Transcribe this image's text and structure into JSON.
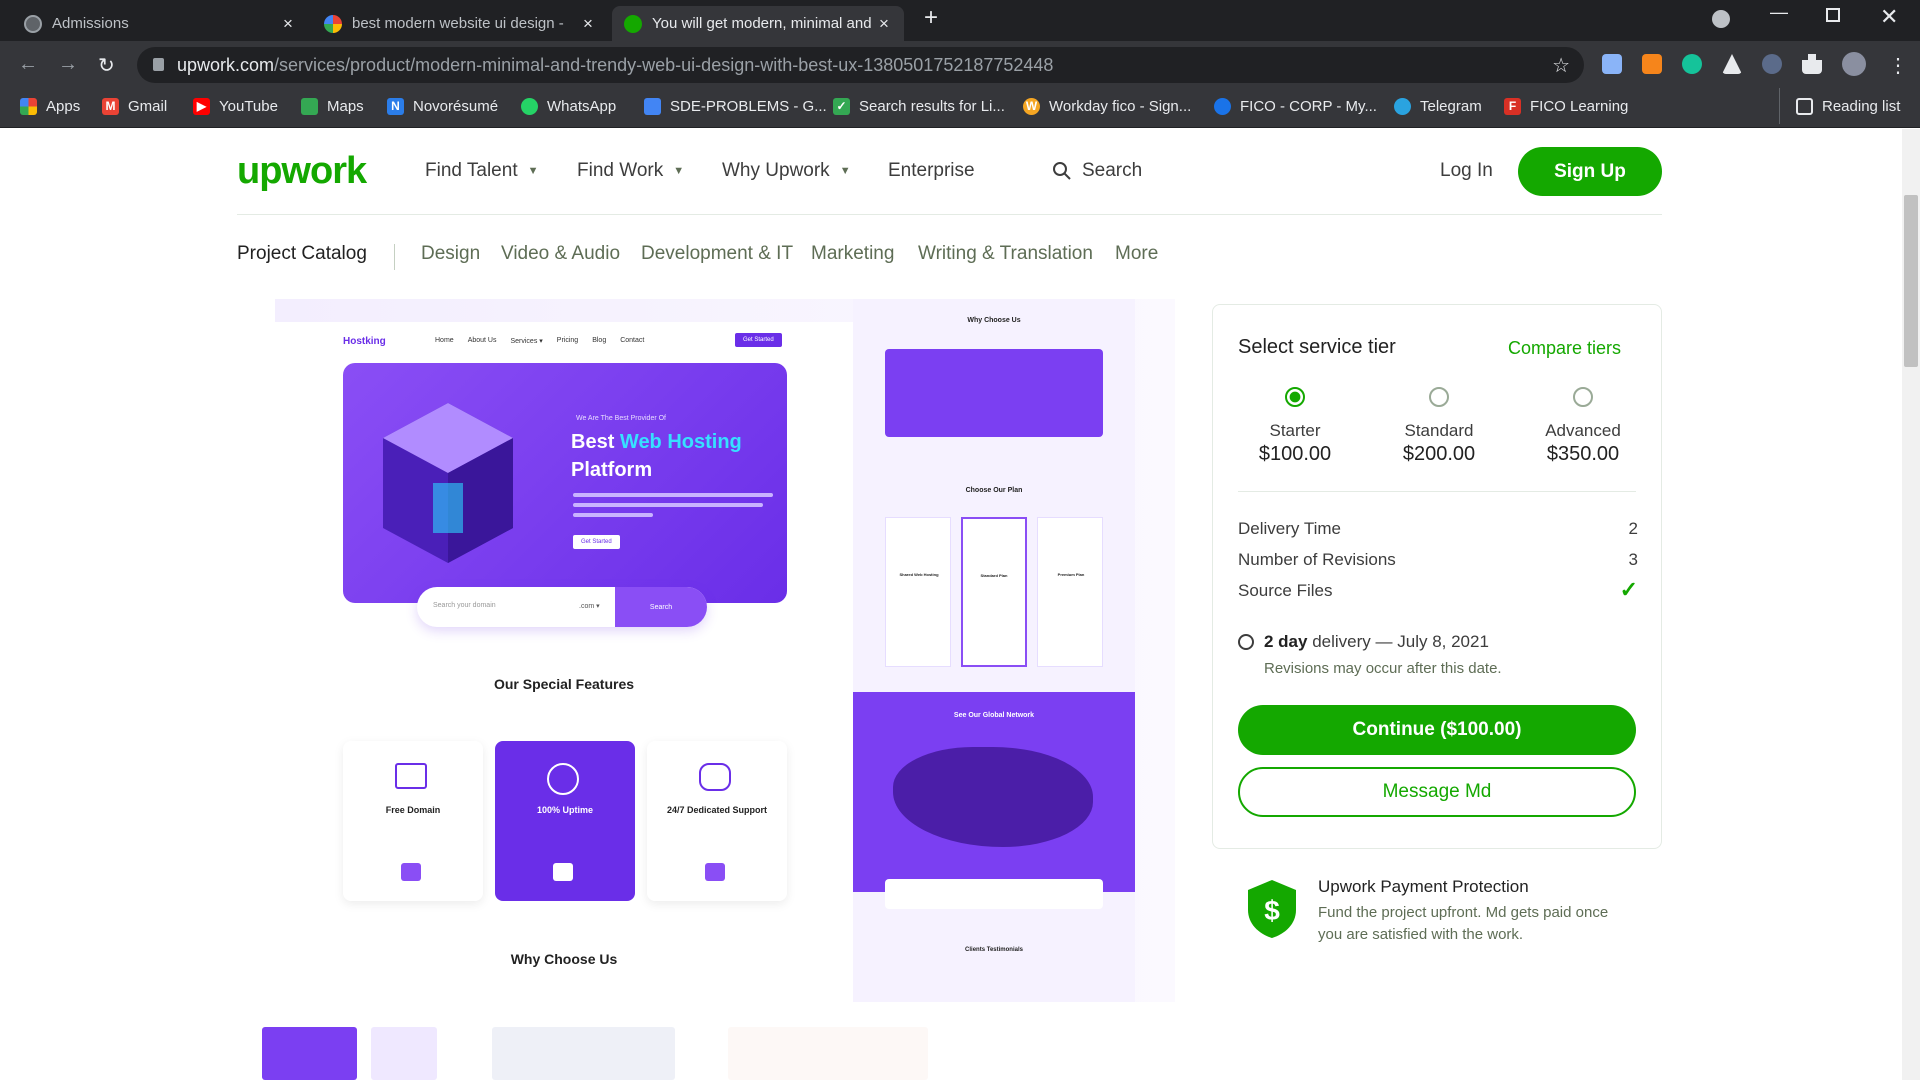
{
  "browser": {
    "tabs": [
      {
        "title": "Admissions"
      },
      {
        "title": "best modern website ui design -"
      },
      {
        "title": "You will get modern, minimal and"
      }
    ],
    "url_host": "upwork.com",
    "url_path": "/services/product/modern-minimal-and-trendy-web-ui-design-with-best-ux-1380501752187752448",
    "bookmarks": [
      "Apps",
      "Gmail",
      "YouTube",
      "Maps",
      "Novorésumé",
      "WhatsApp",
      "SDE-PROBLEMS - G...",
      "Search results for Li...",
      "Workday fico - Sign...",
      "FICO - CORP - My...",
      "Telegram",
      "FICO Learning"
    ],
    "reading_list": "Reading list"
  },
  "header": {
    "logo": "upwork",
    "nav": [
      "Find Talent",
      "Find Work",
      "Why Upwork",
      "Enterprise"
    ],
    "search": "Search",
    "login": "Log In",
    "signup": "Sign Up"
  },
  "categories": [
    "Project Catalog",
    "Design",
    "Video & Audio",
    "Development & IT",
    "Marketing",
    "Writing & Translation",
    "More"
  ],
  "preview": {
    "brand": "Hostking",
    "menu": [
      "Home",
      "About Us",
      "Services ▾",
      "Pricing",
      "Blog",
      "Contact"
    ],
    "cta": "Get Started",
    "hero_kicker": "We Are The Best Provider Of",
    "hero_title_1": "Best",
    "hero_title_accent": "Web Hosting",
    "hero_title_2": "Platform",
    "hero_button": "Get Started",
    "domain_placeholder": "Search your domain",
    "domain_tld": ".com ▾",
    "domain_button": "Search",
    "features_title": "Our Special Features",
    "features": [
      "Free Domain",
      "100% Uptime",
      "24/7 Dedicated Support"
    ],
    "why_title": "Why Choose Us",
    "right_why": "Why Choose Us",
    "right_plan": "Choose Our Plan",
    "plans": [
      "Shared Web Hosting",
      "Standard Plan",
      "Premium Plan"
    ],
    "right_network": "See Our Global Network",
    "right_testimonials": "Clients Testimonials"
  },
  "service": {
    "select_title": "Select service tier",
    "compare": "Compare tiers",
    "tiers": [
      {
        "name": "Starter",
        "price": "$100.00",
        "selected": true
      },
      {
        "name": "Standard",
        "price": "$200.00",
        "selected": false
      },
      {
        "name": "Advanced",
        "price": "$350.00",
        "selected": false
      }
    ],
    "rows": [
      {
        "label": "Delivery Time",
        "value": "2"
      },
      {
        "label": "Number of Revisions",
        "value": "3"
      },
      {
        "label": "Source Files",
        "value": "✓"
      }
    ],
    "delivery_bold": "2 day",
    "delivery_rest": "delivery — July 8, 2021",
    "delivery_note": "Revisions may occur after this date.",
    "continue": "Continue ($100.00)",
    "message": "Message Md"
  },
  "protection": {
    "title": "Upwork Payment Protection",
    "text_1": "Fund the project upfront. Md gets paid once",
    "text_2": "you are satisfied with the work."
  },
  "colors": {
    "brand_green": "#14a800",
    "preview_purple": "#7b3ff2"
  }
}
